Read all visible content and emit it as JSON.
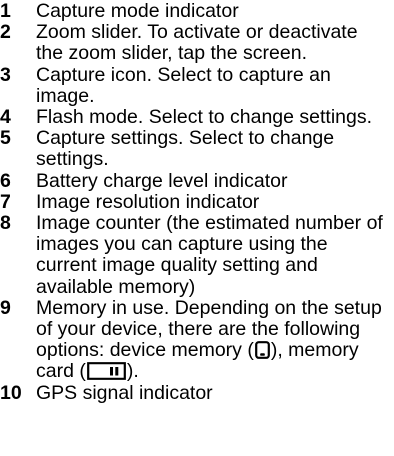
{
  "legend": {
    "items": [
      {
        "number": "1",
        "text": "Capture mode indicator"
      },
      {
        "number": "2",
        "text": "Zoom slider. To activate or deactivate the zoom slider, tap the screen."
      },
      {
        "number": "3",
        "text": "Capture icon. Select to capture an image."
      },
      {
        "number": "4",
        "text": "Flash mode. Select to change settings."
      },
      {
        "number": "5",
        "text": "Capture settings. Select to change settings."
      },
      {
        "number": "6",
        "text": "Battery charge level indicator"
      },
      {
        "number": "7",
        "text": "Image resolution indicator"
      },
      {
        "number": "8",
        "text": "Image counter (the estimated number of images you can capture using the current image quality setting and available memory)"
      },
      {
        "number": "9",
        "text_intro": "Memory in use. Depending on the setup of your device, there are the following options: device memory (",
        "icon_device_memory": "phone-memory-icon",
        "text_middle": "), memory card (",
        "icon_memory_card": "memory-card-icon",
        "text_end": ")."
      },
      {
        "number": "10",
        "text": "GPS signal indicator"
      }
    ]
  }
}
